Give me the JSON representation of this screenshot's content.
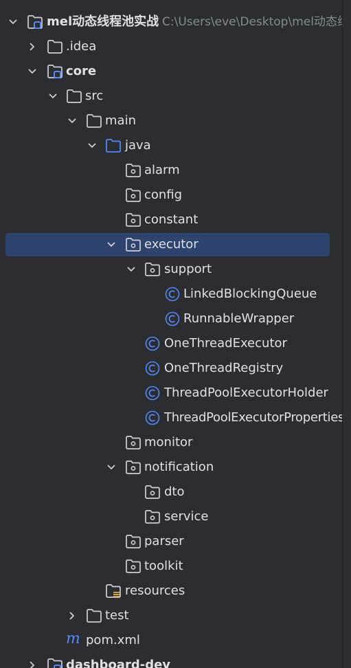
{
  "colors": {
    "background": "#2b2d30",
    "selection": "#2e436e",
    "text": "#dfe1e5",
    "path_text": "#868a91",
    "folder_icon": "#ced0d6",
    "source_folder_icon": "#548af7",
    "class_icon": "#548af7",
    "module_badge": "#548af7",
    "maven_icon": "#548af7"
  },
  "tree": {
    "root": {
      "label": "mel动态线程池实战",
      "path": "C:\\Users\\eve\\Desktop\\mel动态线"
    },
    "idea": {
      "label": ".idea"
    },
    "core": {
      "label": "core"
    },
    "src": {
      "label": "src"
    },
    "main": {
      "label": "main"
    },
    "java": {
      "label": "java"
    },
    "alarm": {
      "label": "alarm"
    },
    "config": {
      "label": "config"
    },
    "constant": {
      "label": "constant"
    },
    "executor": {
      "label": "executor"
    },
    "support": {
      "label": "support"
    },
    "linked_blocking_queue": {
      "label": "LinkedBlockingQueue"
    },
    "runnable_wrapper": {
      "label": "RunnableWrapper"
    },
    "one_thread_executor": {
      "label": "OneThreadExecutor"
    },
    "one_thread_registry": {
      "label": "OneThreadRegistry"
    },
    "thread_pool_executor_holder": {
      "label": "ThreadPoolExecutorHolder"
    },
    "thread_pool_executor_properties": {
      "label": "ThreadPoolExecutorProperties"
    },
    "monitor": {
      "label": "monitor"
    },
    "notification": {
      "label": "notification"
    },
    "dto": {
      "label": "dto"
    },
    "service": {
      "label": "service"
    },
    "parser": {
      "label": "parser"
    },
    "toolkit": {
      "label": "toolkit"
    },
    "resources": {
      "label": "resources"
    },
    "test": {
      "label": "test"
    },
    "pom": {
      "label": "pom.xml"
    },
    "dashboard_dev": {
      "label": "dashboard-dev"
    }
  }
}
